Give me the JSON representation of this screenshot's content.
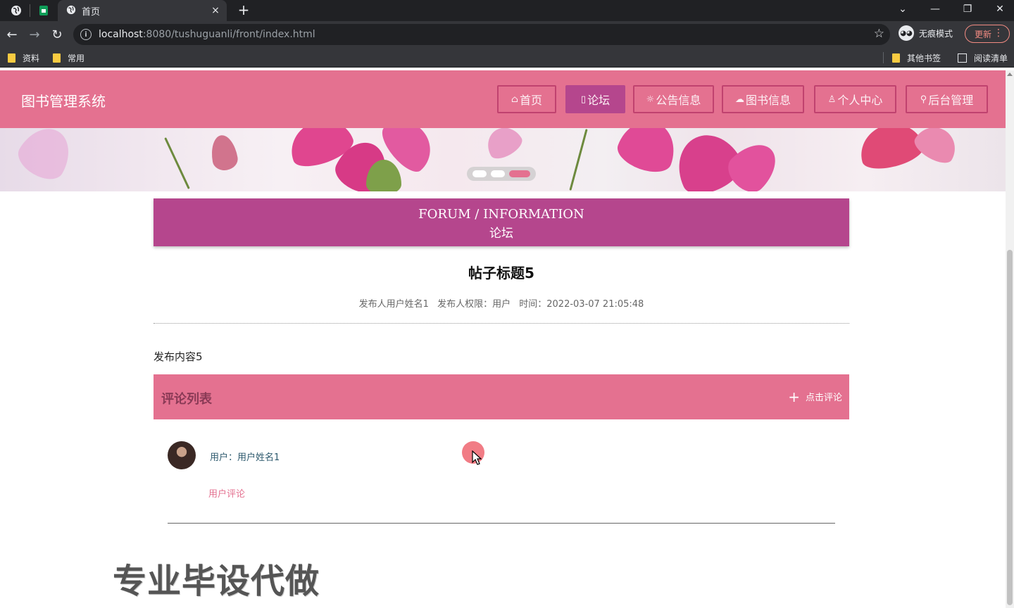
{
  "browser": {
    "tab_title": "首页",
    "tab_close": "×",
    "new_tab": "+",
    "url_host": "localhost",
    "url_path": ":8080/tushuguanli/front/index.html",
    "incognito_label": "无痕模式",
    "update_label": "更新",
    "bookmarks": [
      "资料",
      "常用"
    ],
    "bookmarks_right": [
      "其他书签",
      "阅读清单"
    ]
  },
  "header": {
    "site_title": "图书管理系统",
    "nav": [
      {
        "glyph": "⌂",
        "label": "首页"
      },
      {
        "glyph": "▯",
        "label": "论坛"
      },
      {
        "glyph": "☼",
        "label": "公告信息"
      },
      {
        "glyph": "☁",
        "label": "图书信息"
      },
      {
        "glyph": "♙",
        "label": "个人中心"
      },
      {
        "glyph": "⚲",
        "label": "后台管理"
      }
    ],
    "active_nav_index": 1
  },
  "carousel": {
    "slide_count": 3,
    "active_index": 2
  },
  "section": {
    "title_en": "FORUM / INFORMATION",
    "title_cn": "论坛"
  },
  "post": {
    "title": "帖子标题5",
    "author": "发布人用户姓名1",
    "role": "发布人权限：用户",
    "time": "时间：2022-03-07 21:05:48",
    "content": "发布内容5"
  },
  "comments": {
    "header": "评论列表",
    "add_label": "点击评论",
    "items": [
      {
        "user": "用户：用户姓名1",
        "text": "用户评论"
      }
    ]
  },
  "watermark": "专业毕设代做",
  "colors": {
    "header_bg": "#e47190",
    "active_nav": "#b5468d",
    "section_bg": "#b5468d"
  }
}
